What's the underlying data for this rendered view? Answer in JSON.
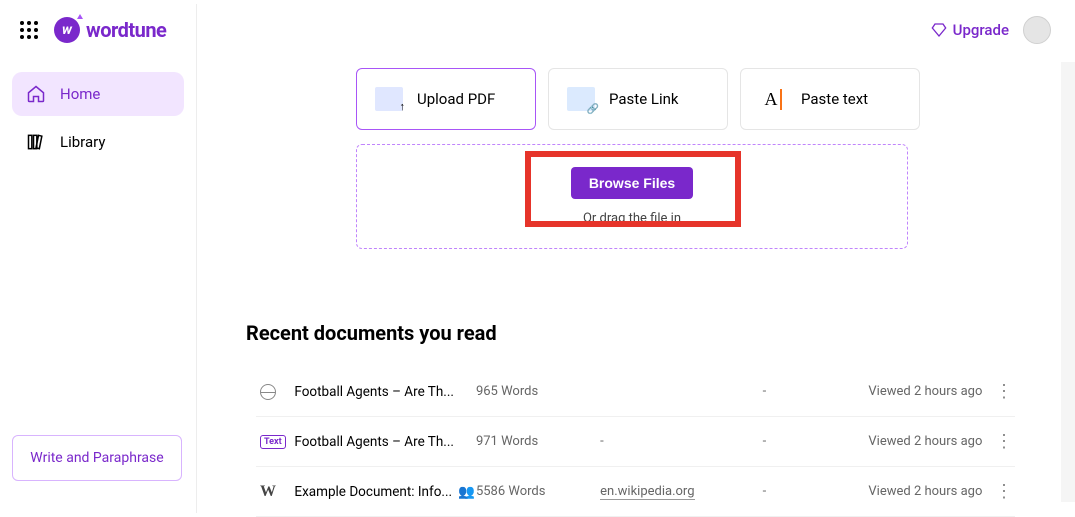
{
  "brand": {
    "name": "wordtune"
  },
  "header": {
    "upgrade_label": "Upgrade"
  },
  "sidebar": {
    "items": [
      {
        "label": "Home"
      },
      {
        "label": "Library"
      }
    ],
    "write_btn": "Write and Paraphrase"
  },
  "tabs": [
    {
      "label": "Upload PDF"
    },
    {
      "label": "Paste Link"
    },
    {
      "label": "Paste text"
    }
  ],
  "dropzone": {
    "browse_label": "Browse Files",
    "hint": "Or drag the file in"
  },
  "recent": {
    "title": "Recent documents you read",
    "docs": [
      {
        "title": "Football Agents – Are Th...",
        "words": "965 Words",
        "col3": "",
        "col4": "-",
        "viewed": "Viewed 2 hours ago"
      },
      {
        "title": "Football Agents – Are Th...",
        "words": "971 Words",
        "col3": "-",
        "col4": "-",
        "viewed": "Viewed 2 hours ago"
      },
      {
        "title": "Example Document: Info...",
        "words": "5586 Words",
        "col3": "en.wikipedia.org",
        "col4": "-",
        "viewed": "Viewed 2 hours ago"
      }
    ]
  }
}
